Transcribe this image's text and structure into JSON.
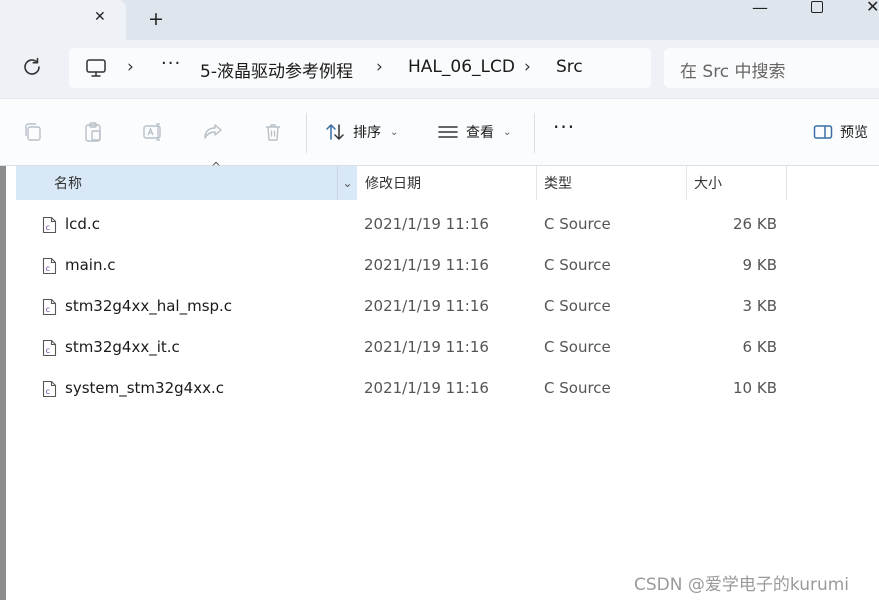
{
  "tab": {
    "close_glyph": "✕",
    "new_tab_glyph": "+"
  },
  "window": {
    "minimize_glyph": "—",
    "close_glyph": "✕"
  },
  "address": {
    "more_label": "···",
    "sep": "›",
    "crumbs": [
      "5-液晶驱动参考例程",
      "HAL_06_LCD",
      "Src"
    ]
  },
  "search": {
    "placeholder": "在 Src 中搜索"
  },
  "toolbar": {
    "sort_label": "排序",
    "view_label": "查看",
    "more_label": "···",
    "preview_label": "预览",
    "caret": "⌄"
  },
  "columns": {
    "name": "名称",
    "date": "修改日期",
    "type": "类型",
    "size": "大小",
    "sort_glyph": "^",
    "drop_glyph": "⌄"
  },
  "files": [
    {
      "name": "lcd.c",
      "date": "2021/1/19 11:16",
      "type": "C Source",
      "size": "26 KB",
      "icon": "c-source-file-icon"
    },
    {
      "name": "main.c",
      "date": "2021/1/19 11:16",
      "type": "C Source",
      "size": "9 KB",
      "icon": "c-source-file-icon"
    },
    {
      "name": "stm32g4xx_hal_msp.c",
      "date": "2021/1/19 11:16",
      "type": "C Source",
      "size": "3 KB",
      "icon": "c-source-file-icon"
    },
    {
      "name": "stm32g4xx_it.c",
      "date": "2021/1/19 11:16",
      "type": "C Source",
      "size": "6 KB",
      "icon": "c-source-file-icon"
    },
    {
      "name": "system_stm32g4xx.c",
      "date": "2021/1/19 11:16",
      "type": "C Source",
      "size": "10 KB",
      "icon": "c-source-file-icon"
    }
  ],
  "watermark": "CSDN @爱学电子的kurumi",
  "colors": {
    "accent_selection": "#d9e8f7",
    "titlebar": "#dfe5ec",
    "chrome": "#eef2f6"
  }
}
